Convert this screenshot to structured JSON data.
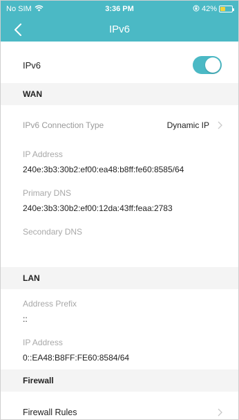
{
  "status_bar": {
    "carrier": "No SIM",
    "time": "3:36 PM",
    "battery_percent": "42%",
    "battery_level": 0.42,
    "icons": [
      "wifi-icon",
      "orientation-lock-icon",
      "battery-icon"
    ]
  },
  "nav": {
    "title": "IPv6",
    "back_icon": "chevron-left-icon"
  },
  "ipv6_toggle": {
    "label": "IPv6",
    "enabled": true
  },
  "wan": {
    "section_title": "WAN",
    "connection_type_label": "IPv6 Connection Type",
    "connection_type_value": "Dynamic IP",
    "ip_address_label": "IP Address",
    "ip_address_value": "240e:3b3:30b2:ef00:ea48:b8ff:fe60:8585/64",
    "primary_dns_label": "Primary DNS",
    "primary_dns_value": "240e:3b3:30b2:ef00:12da:43ff:feaa:2783",
    "secondary_dns_label": "Secondary DNS",
    "secondary_dns_value": ""
  },
  "lan": {
    "section_title": "LAN",
    "address_prefix_label": "Address Prefix",
    "address_prefix_value": "::",
    "ip_address_label": "IP Address",
    "ip_address_value": "0::EA48:B8FF:FE60:8584/64"
  },
  "firewall": {
    "section_title": "Firewall",
    "rules_label": "Firewall Rules"
  },
  "colors": {
    "accent": "#4bb9c5",
    "section_bg": "#f4f4f4",
    "muted_text": "#9a9a9a",
    "battery": "#f5d33b"
  }
}
